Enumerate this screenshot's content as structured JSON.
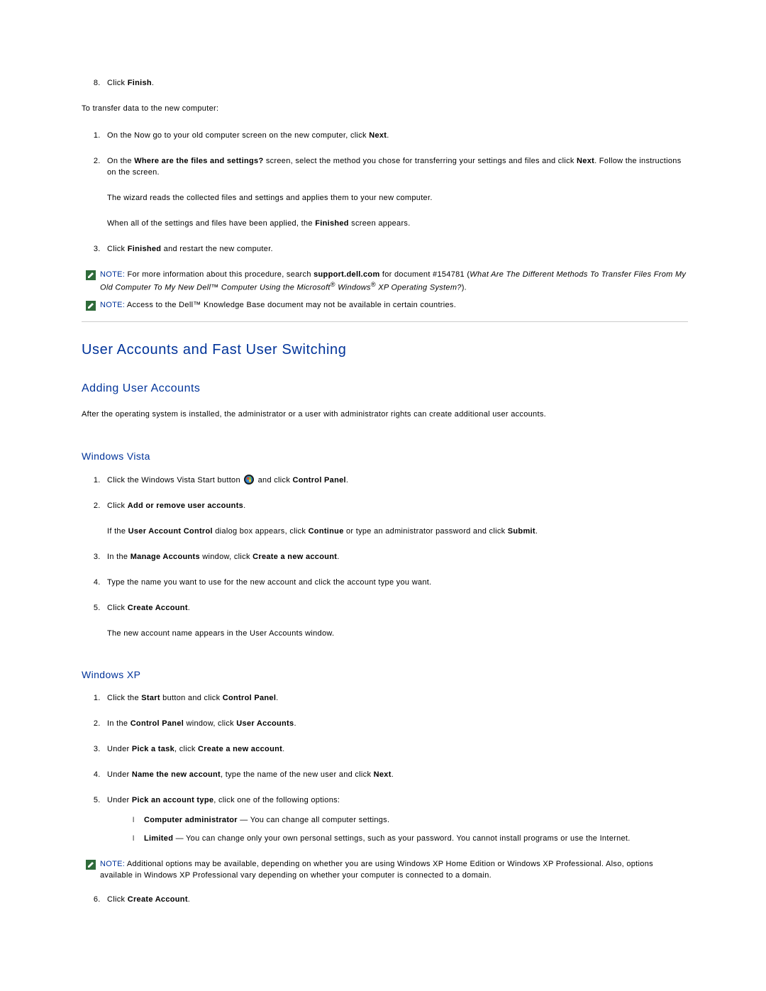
{
  "intro": {
    "step8_pre": "Click ",
    "step8_bold": "Finish",
    "step8_post": ".",
    "transfer_lead": "To transfer data to the new computer:"
  },
  "transfer_steps": {
    "s1": "On the Now go to your old computer screen on the new computer, click ",
    "s1_bold": "Next",
    "s1_post": ".",
    "s2a": "On the ",
    "s2b": "Where are the files and settings?",
    "s2c": " screen, select the method you chose for transferring your settings and files and click ",
    "s2d": "Next",
    "s2e": ". Follow the instructions on the screen.",
    "s2_sub1": "The wizard reads the collected files and settings and applies them to your new computer.",
    "s2_sub2": "When all of the settings and files have been applied, the ",
    "s2_sub2b": "Finished",
    "s2_sub2c": " screen appears.",
    "s3a": "Click ",
    "s3b": "Finished",
    "s3c": " and restart the new computer."
  },
  "note1": {
    "label": "NOTE:",
    "a": " For more information about this procedure, search ",
    "b": "support.dell.com",
    "c": " for document #154781 (",
    "it": "What Are The Different Methods To Transfer Files From My Old Computer To My New Dell™ Computer Using the Microsoft",
    "reg1": "®",
    "it2": " Windows",
    "reg2": "®",
    "it3": " XP Operating System?",
    "end": ")."
  },
  "note2": {
    "label": "NOTE:",
    "text": " Access to the Dell™ Knowledge Base document may not be available in certain countries."
  },
  "headings": {
    "h1": "User Accounts and Fast User Switching",
    "h2": "Adding User Accounts",
    "vista": "Windows Vista",
    "xp": "Windows XP"
  },
  "adding_intro": "After the operating system is installed, the administrator or a user with administrator rights can create additional user accounts.",
  "vista_steps": {
    "s1a": "Click the Windows Vista Start button ",
    "s1b": " and click ",
    "s1c": "Control Panel",
    "s1d": ".",
    "s2a": "Click ",
    "s2b": "Add or remove user accounts",
    "s2c": ".",
    "s2_sub_a": "If the ",
    "s2_sub_b": "User Account Control",
    "s2_sub_c": " dialog box appears, click ",
    "s2_sub_d": "Continue",
    "s2_sub_e": " or type an administrator password and click ",
    "s2_sub_f": "Submit",
    "s2_sub_g": ".",
    "s3a": "In the ",
    "s3b": "Manage Accounts",
    "s3c": " window, click ",
    "s3d": "Create a new account",
    "s3e": ".",
    "s4": "Type the name you want to use for the new account and click the account type you want.",
    "s5a": "Click ",
    "s5b": "Create Account",
    "s5c": ".",
    "s5_sub": "The new account name appears in the User Accounts window."
  },
  "xp_steps": {
    "s1a": "Click the ",
    "s1b": "Start",
    "s1c": " button and click ",
    "s1d": "Control Panel",
    "s1e": ".",
    "s2a": "In the ",
    "s2b": "Control Panel",
    "s2c": " window, click ",
    "s2d": "User Accounts",
    "s2e": ".",
    "s3a": "Under ",
    "s3b": "Pick a task",
    "s3c": ", click ",
    "s3d": "Create a new account",
    "s3e": ".",
    "s4a": "Under ",
    "s4b": "Name the new account",
    "s4c": ", type the name of the new user and click ",
    "s4d": "Next",
    "s4e": ".",
    "s5a": "Under ",
    "s5b": "Pick an account type",
    "s5c": ", click one of the following options:",
    "b1a": "Computer administrator",
    "b1b": " — You can change all computer settings.",
    "b2a": "Limited",
    "b2b": " — You can change only your own personal settings, such as your password. You cannot install programs or use the Internet."
  },
  "note3": {
    "label": "NOTE:",
    "text": " Additional options may be available, depending on whether you are using Windows XP Home Edition or Windows XP Professional. Also, options available in Windows XP Professional vary depending on whether your computer is connected to a domain."
  },
  "xp_step6": {
    "a": "Click ",
    "b": "Create Account",
    "c": "."
  }
}
